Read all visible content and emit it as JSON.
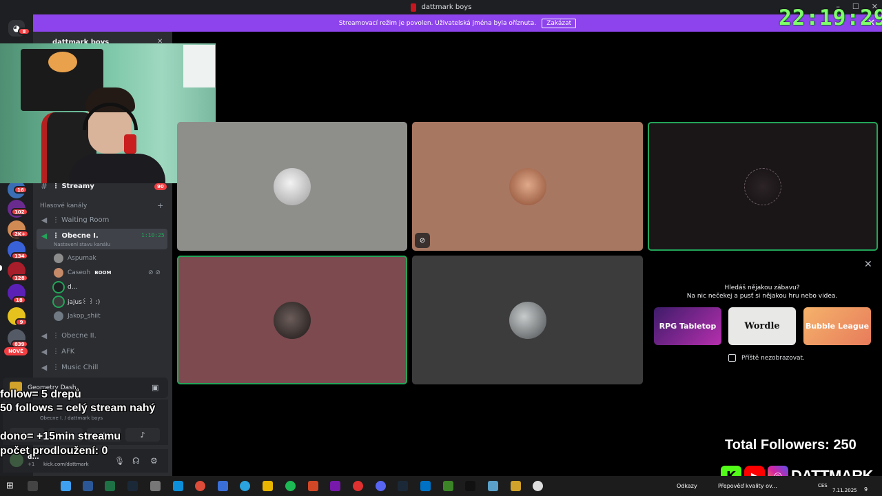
{
  "window": {
    "title": "dattmark boys"
  },
  "banner": {
    "text": "Streamovací režim je povolen. Uživatelská jména byla oříznuta.",
    "button": "Zakázat",
    "close": "✕"
  },
  "clock": "22:19:29",
  "rail": {
    "home_badge": "8",
    "badges": [
      "16",
      "102",
      "2K+",
      "134",
      "128",
      "18",
      "9",
      "839"
    ],
    "new_label": "NOVÉ"
  },
  "sidebar": {
    "server_name": "dattmark boys",
    "text_channel": {
      "name": "⋮ Streamy",
      "badge": "90"
    },
    "category": "Hlasové kanály",
    "voice_channels": {
      "waiting": "⋮ Waiting Room",
      "active": "⋮ Obecne I.",
      "active_timer": "1:10:25",
      "active_status": "Nastavení stavu kanálu",
      "obecne2": "⋮ Obecne II.",
      "afk": "⋮ AFK",
      "music": "⋮ Music Chill"
    },
    "members": [
      "Aspumak",
      "Caseoh",
      "d...",
      "jajus꒰ ꒱ :)",
      "Jakop_shiit"
    ],
    "boom_tag": "BOOM"
  },
  "activity": {
    "game": "Geometry Dash"
  },
  "voice_panel": {
    "channel": "Obecne I. / dattmark boys"
  },
  "user_panel": {
    "name": "d...",
    "subtitle": "+1",
    "url": "kick.com/dattmark"
  },
  "suggestion": {
    "title": "Hledáš nějakou zábavu?",
    "subtitle": "Na nic nečekej a pusť si nějakou hru nebo videa.",
    "cards": [
      "RPG Tabletop",
      "Wordle",
      "Bubble League"
    ],
    "checkbox_label": "Příště nezobrazovat."
  },
  "overlay": {
    "line1": "follow= 5 drepů",
    "line2": "50 follows = celý stream nahý",
    "line3": "dono= +15min streamu",
    "line4": "počet prodloužení: 0",
    "followers": "Total Followers: 250",
    "handle": "DATTMARK"
  },
  "taskbar": {
    "links": "Odkazy",
    "notification": "Přepověď kvality ov...",
    "lang": "CES",
    "date": "7.11.2025",
    "count": "9"
  },
  "colors": {
    "banner": "#8e44ec",
    "speaking": "#23a559",
    "clock": "#7fff6a",
    "badge": "#f23f43"
  }
}
